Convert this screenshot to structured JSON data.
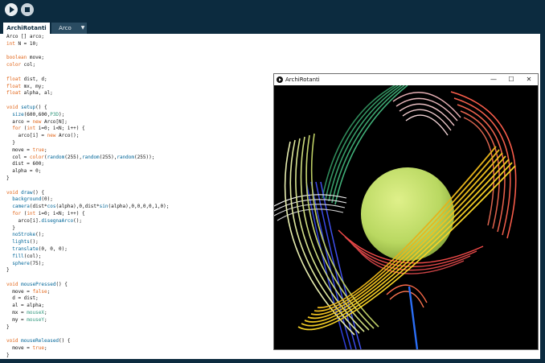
{
  "toolbar": {
    "run_icon": "play-icon",
    "stop_icon": "stop-icon"
  },
  "tabs": [
    {
      "label": "ArchiRotanti",
      "active": true
    },
    {
      "label": "Arco",
      "active": false
    }
  ],
  "tab_menu_glyph": "▼",
  "code": [
    "Arco [] arco;",
    "int N = 10;",
    "",
    "boolean move;",
    "color col;",
    "",
    "float dist, d;",
    "float mx, my;",
    "float alpha, al;",
    "",
    "void setup() {",
    "  size(600,600,P3D);",
    "  arco = new Arco[N];",
    "  for (int i=0; i<N; i++) {",
    "    arco[i] = new Arco();",
    "  }",
    "  move = true;",
    "  col = color(random(255),random(255),random(255));",
    "  dist = 600;",
    "  alpha = 0;",
    "}",
    "",
    "void draw() {",
    "  background(0);",
    "  camera(dist*cos(alpha),0,dist*sin(alpha),0,0,0,0,1,0);",
    "  for (int i=0; i<N; i++) {",
    "    arco[i].disegnaArco();",
    "  }",
    "  noStroke();",
    "  lights();",
    "  translate(0, 0, 0);",
    "  fill(col);",
    "  sphere(75);",
    "}",
    "",
    "void mousePressed() {",
    "  move = false;",
    "  d = dist;",
    "  al = alpha;",
    "  mx = mouseX;",
    "  my = mouseY;",
    "}",
    "",
    "void mouseReleased() {",
    "  move = true;",
    "}"
  ],
  "sketch_window": {
    "title": "ArchiRotanti",
    "minimize_glyph": "—",
    "maximize_glyph": "☐",
    "close_glyph": "✕",
    "background": "#000000",
    "sphere_color": "#c6e36f"
  },
  "colors": {
    "ide_background": "#0c2b3f",
    "keyword": "#e2661a",
    "function": "#006699",
    "constant": "#33997e"
  }
}
